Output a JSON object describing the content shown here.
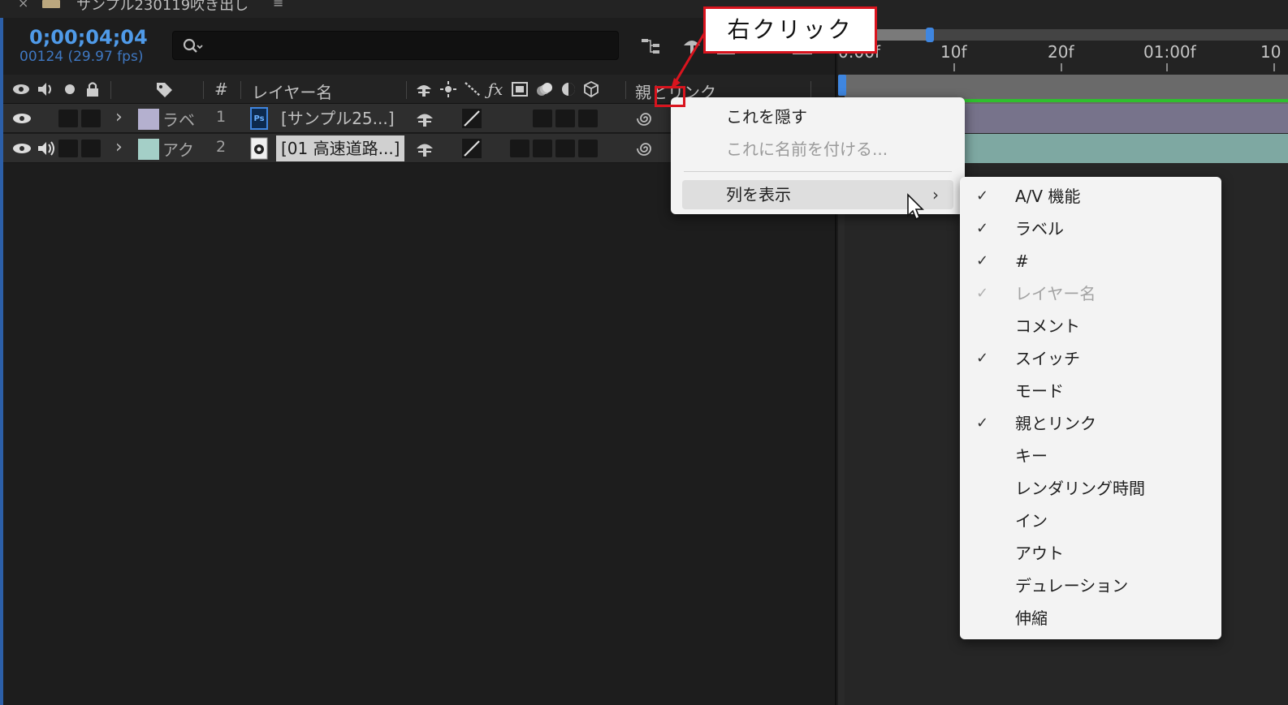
{
  "window": {
    "tab_title": "サンプル230119吹き出し",
    "close_glyph": "×",
    "menu_glyph": "≡"
  },
  "timeline": {
    "timecode": "0;00;04;04",
    "frames": "00124 (29.97 fps)",
    "search_placeholder": ""
  },
  "columns": {
    "num_header": "#",
    "layer_name_header": "レイヤー名",
    "parent_header": "親とリンク"
  },
  "layers": [
    {
      "label_text": "ラベ",
      "label_color": "#b4b0cf",
      "number": "1",
      "name": "[サンプル25...]",
      "file_type": "Ps",
      "selected": false
    },
    {
      "label_text": "アク",
      "label_color": "#a4cfc7",
      "number": "2",
      "name": "[01 高速道路...]",
      "file_type": "video",
      "selected": true
    }
  ],
  "ruler": {
    "labels": [
      "0:00f",
      "10f",
      "20f",
      "01:00f",
      "10"
    ]
  },
  "context_menu": {
    "items": [
      {
        "label": "これを隠す",
        "disabled": false
      },
      {
        "label": "これに名前を付ける...",
        "disabled": true
      },
      {
        "label": "列を表示",
        "disabled": false,
        "has_submenu": true,
        "submenu_arrow": "›"
      }
    ]
  },
  "submenu": {
    "items": [
      {
        "label": "A/V 機能",
        "checked": true,
        "disabled": false
      },
      {
        "label": "ラベル",
        "checked": true,
        "disabled": false
      },
      {
        "label": "#",
        "checked": true,
        "disabled": false
      },
      {
        "label": "レイヤー名",
        "checked": true,
        "disabled": true
      },
      {
        "label": "コメント",
        "checked": false,
        "disabled": false
      },
      {
        "label": "スイッチ",
        "checked": true,
        "disabled": false
      },
      {
        "label": "モード",
        "checked": false,
        "disabled": false
      },
      {
        "label": "親とリンク",
        "checked": true,
        "disabled": false
      },
      {
        "label": "キー",
        "checked": false,
        "disabled": false
      },
      {
        "label": "レンダリング時間",
        "checked": false,
        "disabled": false
      },
      {
        "label": "イン",
        "checked": false,
        "disabled": false
      },
      {
        "label": "アウト",
        "checked": false,
        "disabled": false
      },
      {
        "label": "デュレーション",
        "checked": false,
        "disabled": false
      },
      {
        "label": "伸縮",
        "checked": false,
        "disabled": false
      }
    ],
    "check_glyph": "✓"
  },
  "annotation": {
    "text": "右クリック",
    "color": "#d9141e"
  },
  "colors": {
    "accent_blue": "#4f9ae8",
    "panel_bg": "#1d1d1d"
  }
}
